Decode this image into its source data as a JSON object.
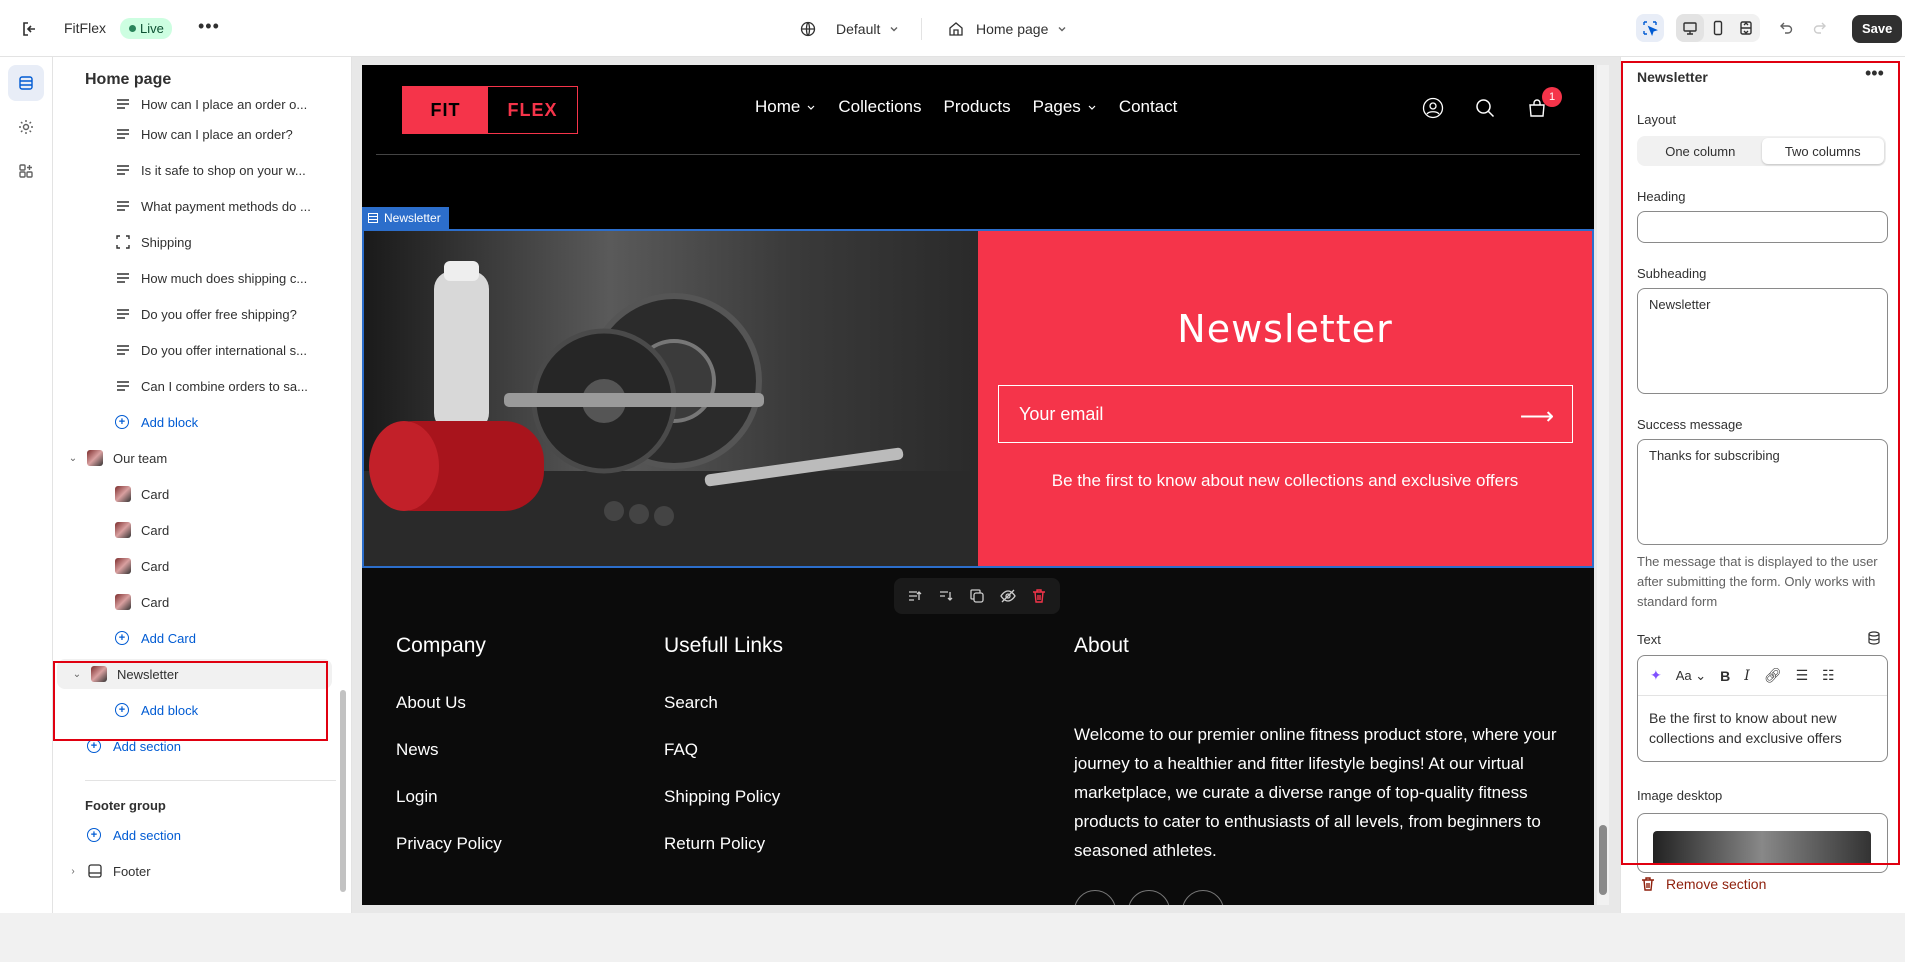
{
  "topbar": {
    "store_name": "FitFlex",
    "status": "Live",
    "theme": "Default",
    "page": "Home page",
    "save_label": "Save"
  },
  "sidebar": {
    "title": "Home page",
    "items": [
      {
        "label": "How can I place an order o...",
        "type": "text"
      },
      {
        "label": "How can I place an order?",
        "type": "text"
      },
      {
        "label": "Is it safe to shop on your w...",
        "type": "text"
      },
      {
        "label": "What payment methods do ...",
        "type": "text"
      },
      {
        "label": "Shipping",
        "type": "dashed"
      },
      {
        "label": "How much does shipping c...",
        "type": "text"
      },
      {
        "label": "Do you offer free shipping?",
        "type": "text"
      },
      {
        "label": "Do you offer international s...",
        "type": "text"
      },
      {
        "label": "Can I combine orders to sa...",
        "type": "text"
      }
    ],
    "add_block_1": "Add block",
    "our_team": "Our team",
    "cards": [
      "Card",
      "Card",
      "Card",
      "Card"
    ],
    "add_card": "Add Card",
    "newsletter": "Newsletter",
    "add_block_2": "Add block",
    "add_section_1": "Add section",
    "footer_group": "Footer group",
    "add_section_2": "Add section",
    "footer": "Footer"
  },
  "preview": {
    "logo_left": "FIT",
    "logo_right": "FLEX",
    "nav": [
      "Home",
      "Collections",
      "Products",
      "Pages",
      "Contact"
    ],
    "cart_count": "1",
    "section_tag": "Newsletter",
    "newsletter_title": "Newsletter",
    "email_placeholder": "Your email",
    "newsletter_text": "Be the first to know about new collections and exclusive offers",
    "footer": {
      "col1_title": "Company",
      "col1_links": [
        "About Us",
        "News",
        "Login",
        "Privacy Policy"
      ],
      "col2_title": "Usefull Links",
      "col2_links": [
        "Search",
        "FAQ",
        "Shipping Policy",
        "Return Policy"
      ],
      "col3_title": "About",
      "about_text": "Welcome to our premier online fitness product store, where your journey to a healthier and fitter lifestyle begins! At our virtual marketplace, we curate a diverse range of top-quality fitness products to cater to enthusiasts of all levels, from beginners to seasoned athletes."
    }
  },
  "settings": {
    "title": "Newsletter",
    "layout_label": "Layout",
    "layout_options": [
      "One column",
      "Two columns"
    ],
    "heading_label": "Heading",
    "heading_value": "",
    "subheading_label": "Subheading",
    "subheading_value": "Newsletter",
    "success_label": "Success message",
    "success_value": "Thanks for subscribing",
    "success_hint": "The message that is displayed to the user after submitting the form. Only works with standard form",
    "text_label": "Text",
    "text_value": "Be the first to know about new collections and exclusive offers",
    "image_label": "Image desktop",
    "remove_label": "Remove section"
  },
  "colors": {
    "brand": "#f5344a",
    "selection": "#2c6ecb",
    "highlight": "#e00010"
  }
}
